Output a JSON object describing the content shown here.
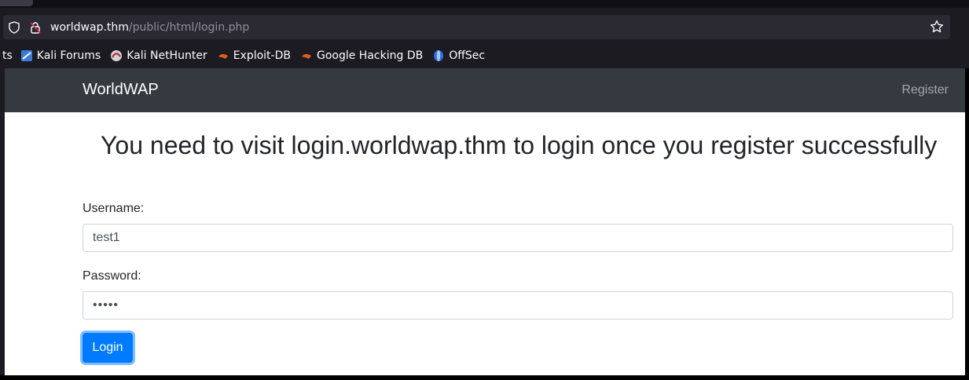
{
  "browser": {
    "url_host": "worldwap.thm",
    "url_path": "/public/html/login.php",
    "bookmarks": [
      {
        "label": "ts",
        "icon": "cut-off-bookmark"
      },
      {
        "label": "Kali Forums",
        "icon": "kali-forums-icon"
      },
      {
        "label": "Kali NetHunter",
        "icon": "kali-nethunter-icon"
      },
      {
        "label": "Exploit-DB",
        "icon": "exploit-db-icon"
      },
      {
        "label": "Google Hacking DB",
        "icon": "ghdb-icon"
      },
      {
        "label": "OffSec",
        "icon": "offsec-icon"
      }
    ]
  },
  "navbar": {
    "brand": "WorldWAP",
    "register": "Register"
  },
  "main": {
    "headline": "You need to visit login.worldwap.thm to login once you register successfully",
    "username_label": "Username:",
    "username_value": "test1",
    "password_label": "Password:",
    "password_value": "•••••",
    "login_button": "Login"
  },
  "colors": {
    "navbar_bg": "#343a40",
    "primary": "#007bff",
    "browser_chrome": "#1c1b22",
    "urlbar_bg": "#2b2a33"
  }
}
